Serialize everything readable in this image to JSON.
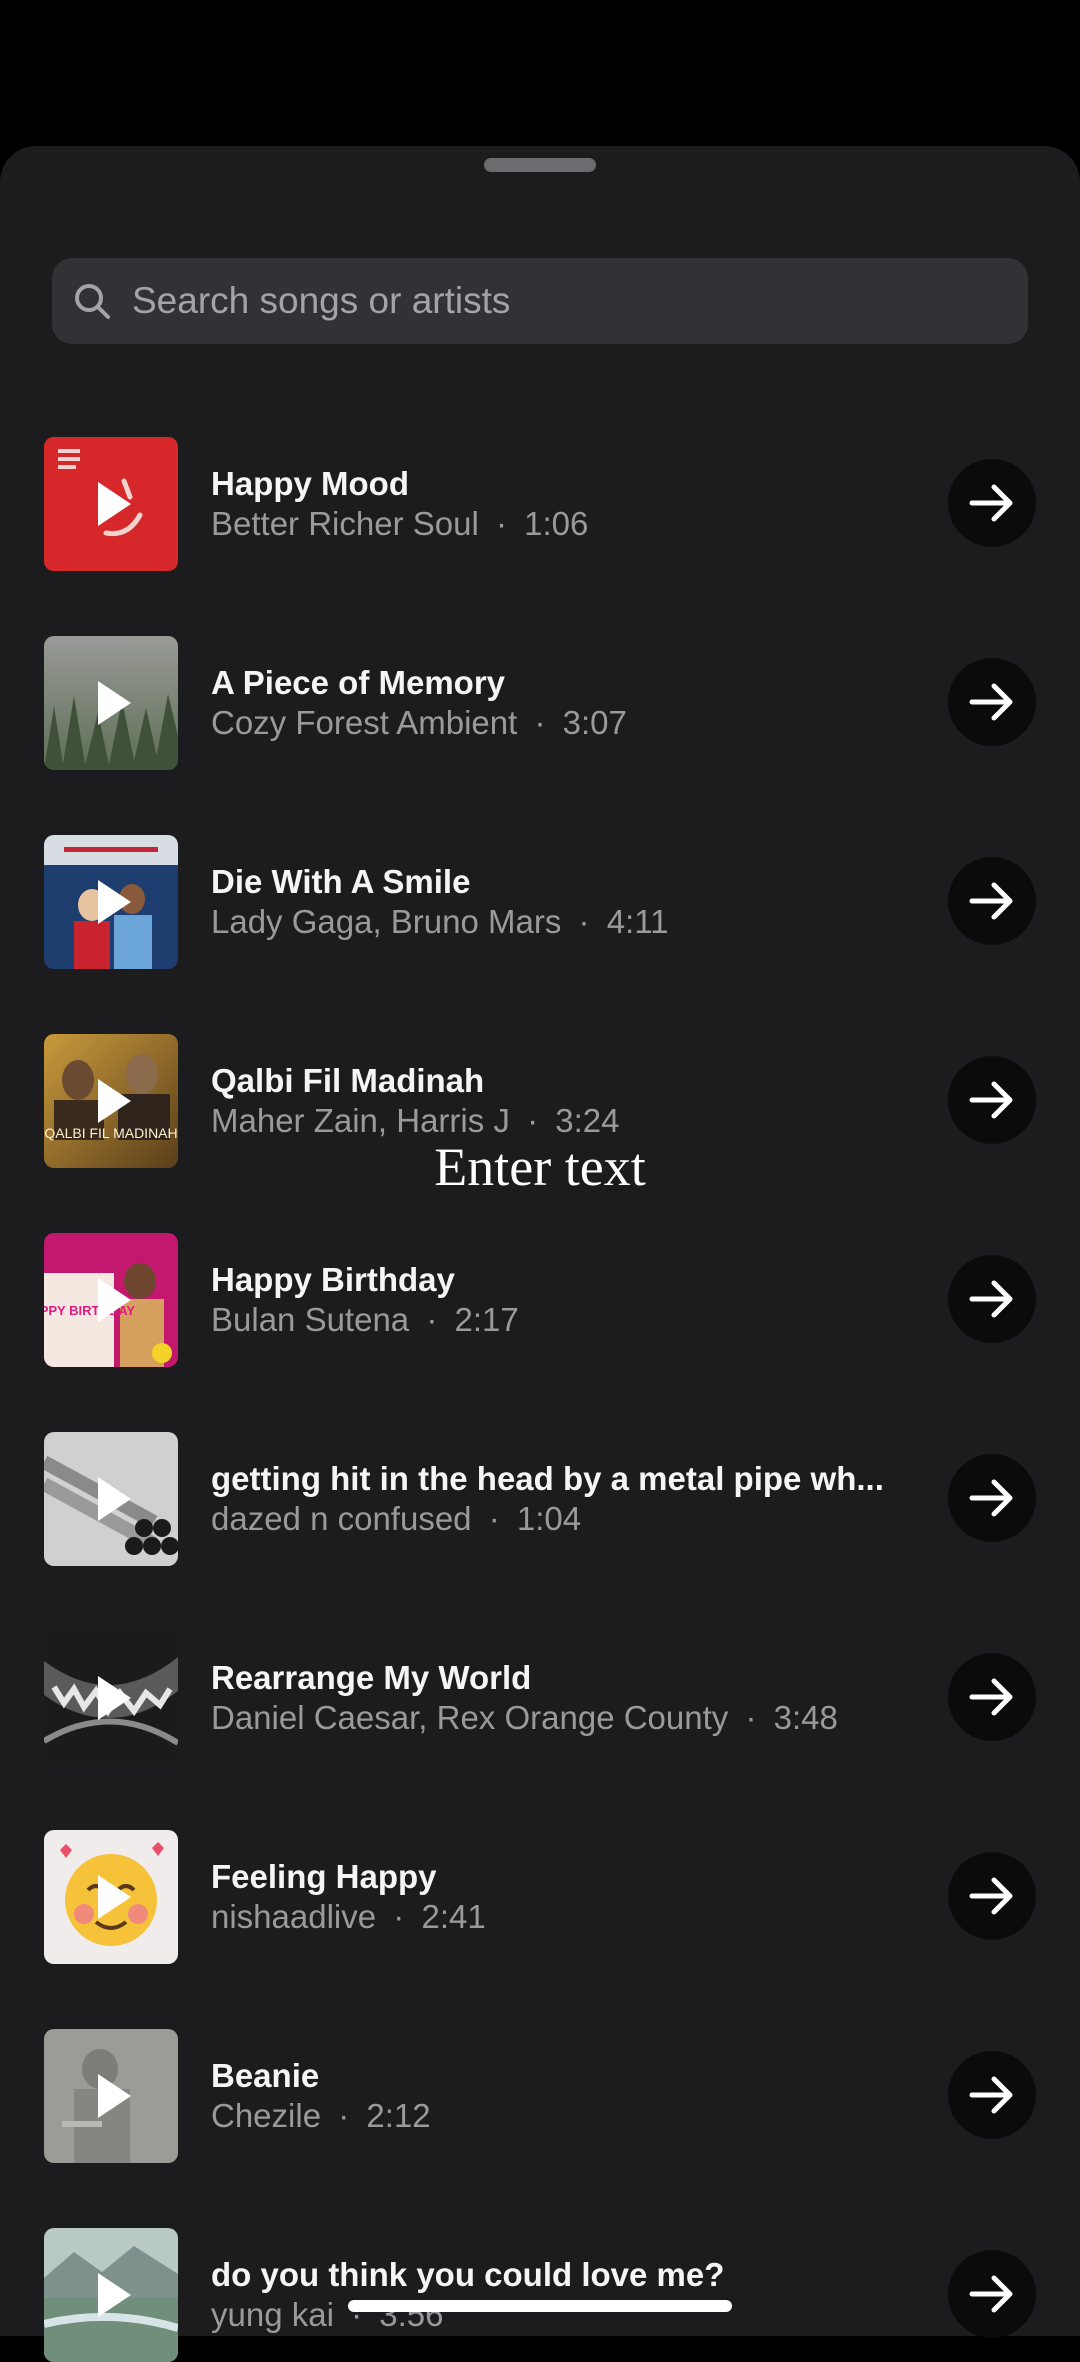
{
  "search": {
    "placeholder": "Search songs or artists"
  },
  "overlay_text": "Enter text",
  "songs": [
    {
      "title": "Happy Mood",
      "artist": "Better Richer Soul",
      "duration": "1:06",
      "separator": "·"
    },
    {
      "title": "A Piece of Memory",
      "artist": "Cozy Forest Ambient",
      "duration": "3:07",
      "separator": "·"
    },
    {
      "title": "Die With A Smile",
      "artist": "Lady Gaga, Bruno Mars",
      "duration": "4:11",
      "separator": "·"
    },
    {
      "title": "Qalbi Fil Madinah",
      "artist": "Maher Zain, Harris J",
      "duration": "3:24",
      "separator": "·"
    },
    {
      "title": "Happy Birthday",
      "artist": "Bulan Sutena",
      "duration": "2:17",
      "separator": "·"
    },
    {
      "title": "getting hit in the head by a metal pipe wh...",
      "artist": "dazed n confused",
      "duration": "1:04",
      "separator": "·"
    },
    {
      "title": "Rearrange My World",
      "artist": "Daniel Caesar, Rex Orange County",
      "duration": "3:48",
      "separator": "·"
    },
    {
      "title": "Feeling Happy",
      "artist": "nishaadlive",
      "duration": "2:41",
      "separator": "·"
    },
    {
      "title": "Beanie",
      "artist": "Chezile",
      "duration": "2:12",
      "separator": "·"
    },
    {
      "title": "do you think you could love me?",
      "artist": "yung kai",
      "duration": "3:56",
      "separator": "·"
    }
  ],
  "artwork_text": {
    "qalbi": "QALBI FIL MADINAH",
    "birthday": "HAPPY BIRTHDAY"
  },
  "icons": {
    "search": "search-icon",
    "play": "play-icon",
    "go": "arrow-right-icon"
  }
}
